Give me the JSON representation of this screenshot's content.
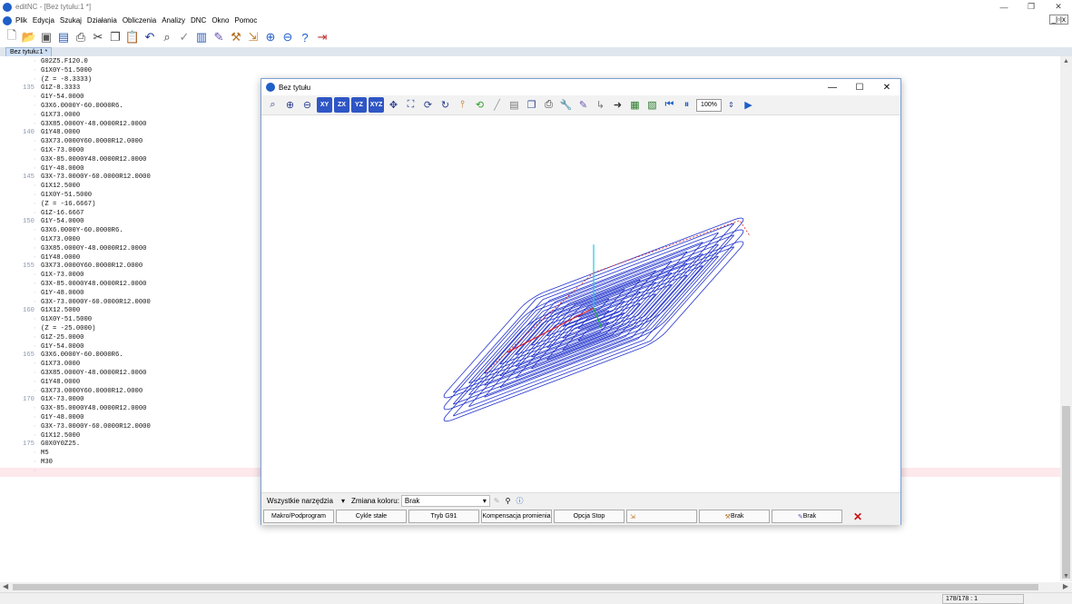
{
  "window": {
    "title": "editNC - [Bez tytułu:1 *]",
    "minimize": "—",
    "restore": "❐",
    "close": "✕"
  },
  "menu": {
    "items": [
      "Plik",
      "Edycja",
      "Szukaj",
      "Działania",
      "Obliczenia",
      "Analizy",
      "DNC",
      "Okno",
      "Pomoc"
    ],
    "mdi_buttons": "_|▫|x"
  },
  "toolbar": {
    "icons": [
      "new-file-icon",
      "open-folder-icon",
      "save-icon",
      "save-as-icon",
      "print-icon",
      "cut-icon",
      "copy-icon",
      "paste-icon",
      "undo-icon",
      "find-icon",
      "check-icon",
      "toolpath-icon",
      "simulate-icon",
      "tool-icon",
      "transfer-icon",
      "upload-icon",
      "download-icon",
      "help-icon",
      "exit-icon"
    ]
  },
  "tab": {
    "label": "Bez tytułu:1 *"
  },
  "editor": {
    "lines": [
      {
        "num": "",
        "text": "G02Z5.F120.0"
      },
      {
        "num": "",
        "text": "G1X0Y-51.5000"
      },
      {
        "num": "",
        "text": "(Z = -8.3333)"
      },
      {
        "num": "135",
        "text": "G1Z-8.3333"
      },
      {
        "num": "",
        "text": "G1Y-54.0000"
      },
      {
        "num": "",
        "text": "G3X6.0000Y-60.0000R6."
      },
      {
        "num": "",
        "text": "G1X73.0000"
      },
      {
        "num": "",
        "text": "G3X85.0000Y-48.0000R12.0000"
      },
      {
        "num": "140",
        "text": "G1Y48.0000"
      },
      {
        "num": "",
        "text": "G3X73.0000Y60.0000R12.0000"
      },
      {
        "num": "",
        "text": "G1X-73.0000"
      },
      {
        "num": "",
        "text": "G3X-85.0000Y48.0000R12.0000"
      },
      {
        "num": "",
        "text": "G1Y-48.0000"
      },
      {
        "num": "145",
        "text": "G3X-73.0000Y-60.0000R12.0000"
      },
      {
        "num": "",
        "text": "G1X12.5000"
      },
      {
        "num": "",
        "text": "G1X0Y-51.5000"
      },
      {
        "num": "",
        "text": "(Z = -16.6667)"
      },
      {
        "num": "",
        "text": "G1Z-16.6667"
      },
      {
        "num": "150",
        "text": "G1Y-54.0000"
      },
      {
        "num": "",
        "text": "G3X6.0000Y-60.0000R6."
      },
      {
        "num": "",
        "text": "G1X73.0000"
      },
      {
        "num": "",
        "text": "G3X85.0000Y-48.0000R12.0000"
      },
      {
        "num": "",
        "text": "G1Y48.0000"
      },
      {
        "num": "155",
        "text": "G3X73.0000Y60.0000R12.0000"
      },
      {
        "num": "",
        "text": "G1X-73.0000"
      },
      {
        "num": "",
        "text": "G3X-85.0000Y48.0000R12.0000"
      },
      {
        "num": "",
        "text": "G1Y-48.0000"
      },
      {
        "num": "",
        "text": "G3X-73.0000Y-60.0000R12.0000"
      },
      {
        "num": "160",
        "text": "G1X12.5000"
      },
      {
        "num": "",
        "text": "G1X0Y-51.5000"
      },
      {
        "num": "",
        "text": "(Z = -25.0000)"
      },
      {
        "num": "",
        "text": "G1Z-25.0000"
      },
      {
        "num": "",
        "text": "G1Y-54.0000"
      },
      {
        "num": "165",
        "text": "G3X6.0000Y-60.0000R6."
      },
      {
        "num": "",
        "text": "G1X73.0000"
      },
      {
        "num": "",
        "text": "G3X85.0000Y-48.0000R12.0000"
      },
      {
        "num": "",
        "text": "G1Y48.0000"
      },
      {
        "num": "",
        "text": "G3X73.0000Y60.0000R12.0000"
      },
      {
        "num": "170",
        "text": "G1X-73.0000"
      },
      {
        "num": "",
        "text": "G3X-85.0000Y48.0000R12.0000"
      },
      {
        "num": "",
        "text": "G1Y-48.0000"
      },
      {
        "num": "",
        "text": "G3X-73.0000Y-60.0000R12.0000"
      },
      {
        "num": "",
        "text": "G1X12.5000"
      },
      {
        "num": "175",
        "text": "G0X0Y0Z25."
      },
      {
        "num": "",
        "text": "M5"
      },
      {
        "num": "",
        "text": "M30"
      },
      {
        "num": "",
        "text": ""
      }
    ]
  },
  "status": {
    "position": "178/178 : 1"
  },
  "viewer": {
    "title": "Bez tytułu",
    "minimize": "—",
    "maximize": "☐",
    "close": "✕",
    "view_buttons": [
      "XY",
      "ZX",
      "YZ",
      "XYZ"
    ],
    "zoom": "100%",
    "tools_label": "Wszystkie narzędzia",
    "color_label": "Zmiana koloru:",
    "color_value": "Brak",
    "buttons": [
      "Makro/Podprogram",
      "Cykle stałe",
      "Tryb G91",
      "Kompensacja promienia",
      "Opcja Stop"
    ],
    "tool_brak_1": "Brak",
    "tool_brak_2": "Brak"
  },
  "colors": {
    "path": "#2233cc",
    "rapid": "#dd2222",
    "axis_x": "#e02020",
    "axis_y": "#20b040",
    "axis_z": "#20c8e0",
    "accent": "#2f56c5"
  }
}
